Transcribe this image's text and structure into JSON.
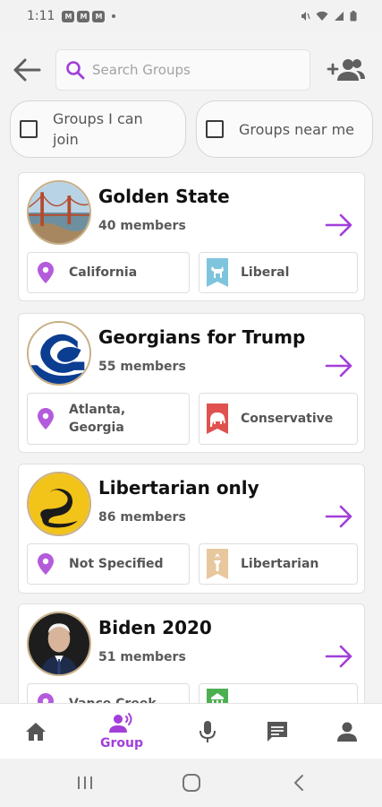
{
  "status_bar": {
    "time": "1:11",
    "notification_icons": [
      "M",
      "M",
      "M"
    ]
  },
  "header": {
    "search_placeholder": "Search Groups",
    "filters": [
      {
        "label": "Groups I can join",
        "checked": false
      },
      {
        "label": "Groups near me",
        "checked": false
      }
    ]
  },
  "groups": [
    {
      "name": "Golden State",
      "members": "40 members",
      "location": "California",
      "affiliation": "Liberal",
      "affiliation_icon": "donkey-icon",
      "banner_color": "#7fc4dd"
    },
    {
      "name": "Georgians for Trump",
      "members": "55 members",
      "location": "Atlanta, Georgia",
      "affiliation": "Conservative",
      "affiliation_icon": "elephant-icon",
      "banner_color": "#e0524f"
    },
    {
      "name": "Libertarian only",
      "members": "86 members",
      "location": "Not Specified",
      "affiliation": "Libertarian",
      "affiliation_icon": "torch-icon",
      "banner_color": "#e7c79d"
    },
    {
      "name": "Biden 2020",
      "members": "51 members",
      "location": "Vance Creek",
      "affiliation": "",
      "affiliation_icon": "seal-icon",
      "banner_color": "#4caf50"
    }
  ],
  "bottom_nav": {
    "active": "Group",
    "items": [
      "home",
      "group",
      "mic",
      "chat",
      "profile"
    ]
  },
  "colors": {
    "accent": "#a23fd9",
    "location_pin": "#b45bdc"
  }
}
